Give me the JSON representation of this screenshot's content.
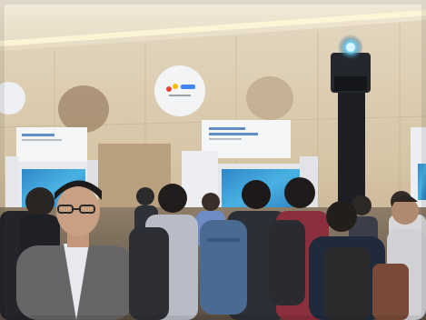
{
  "scene": {
    "description_hidden": "",
    "palette": {
      "wall": "#d8c9ad",
      "ceiling": "#efe6d4",
      "ceiling_light": "#fff4d2",
      "dark_clothing": "#2a2c33",
      "screen": "#3a9fd8",
      "kiosk": "#f1f2f4",
      "skin": "#c99a7c"
    }
  }
}
